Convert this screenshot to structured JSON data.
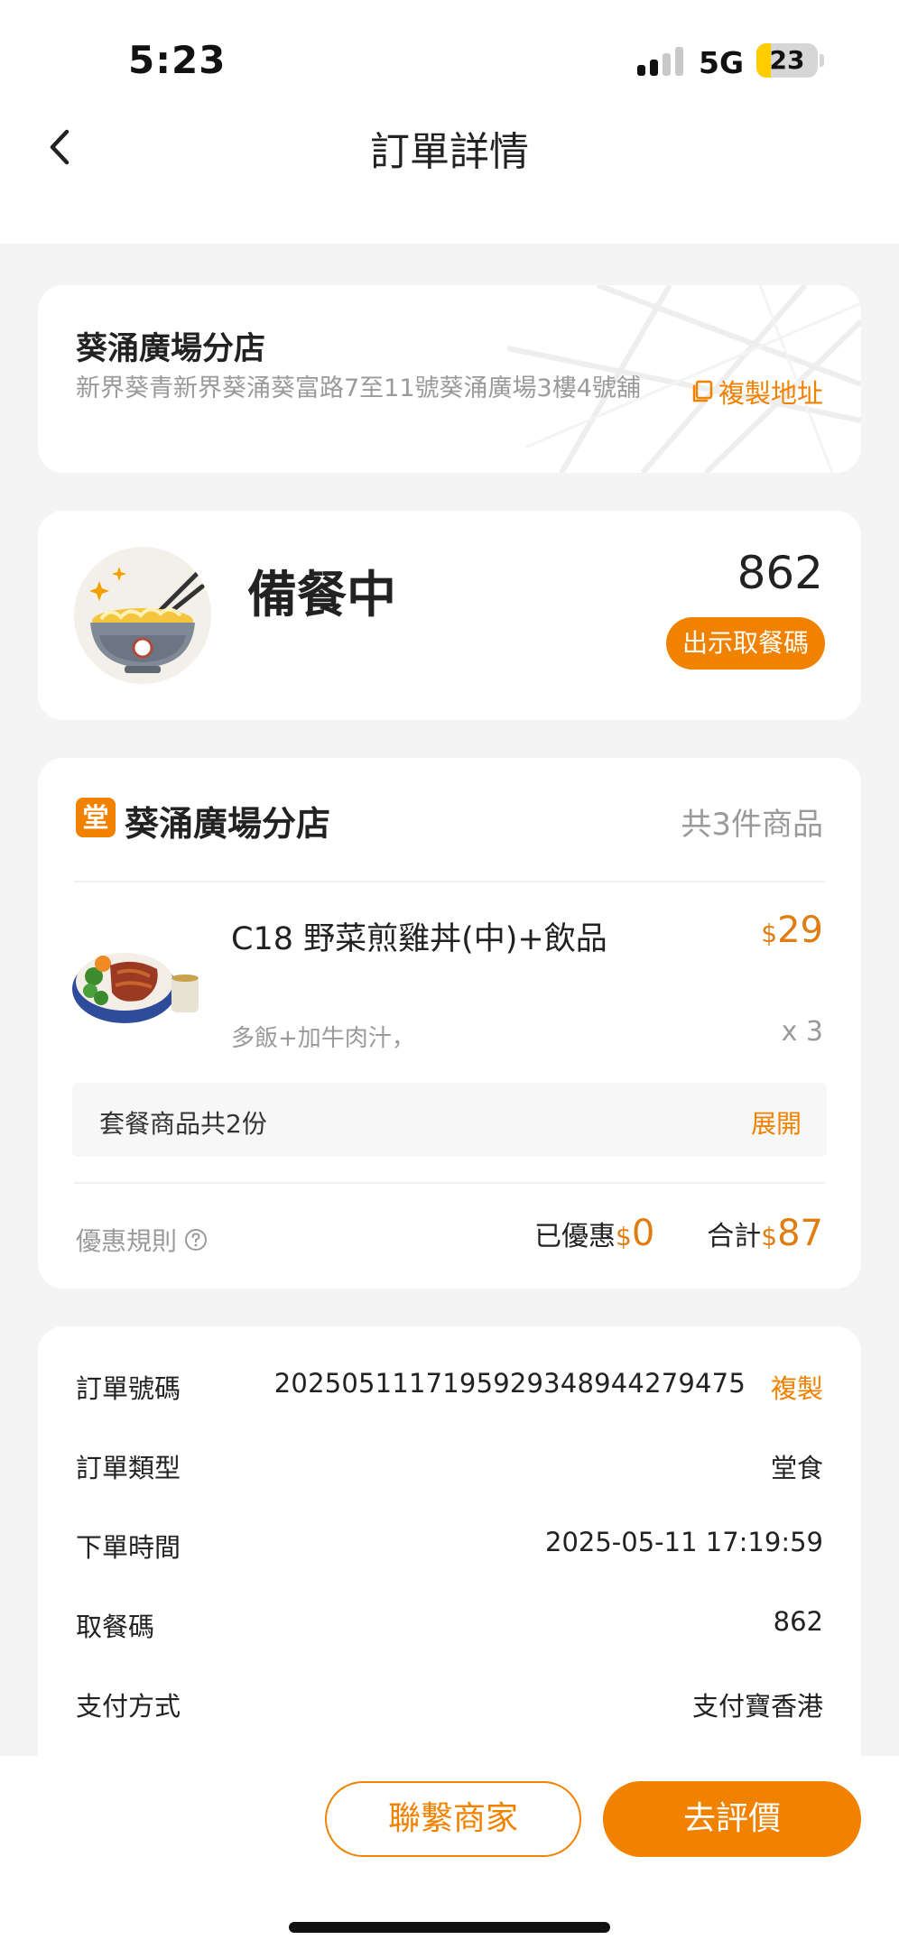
{
  "status_bar": {
    "time": "5:23",
    "network": "5G",
    "battery_level": "23",
    "battery_fraction": 0.23,
    "signal_bars_active": 2,
    "signal_bars_total": 4
  },
  "header": {
    "title": "訂單詳情",
    "back_icon": "chevron-left-icon"
  },
  "store": {
    "name": "葵涌廣場分店",
    "address": "新界葵青新界葵涌葵富路7至11號葵涌廣場3樓4號舖",
    "copy_address_label": "複製地址"
  },
  "order_status": {
    "status": "備餐中",
    "pickup_number": "862",
    "show_code_label": "出示取餐碼"
  },
  "items_section": {
    "badge": "堂",
    "store_name": "葵涌廣場分店",
    "item_count": "共3件商品",
    "items": [
      {
        "name": "C18 野菜煎雞丼(中)+飲品",
        "currency": "$",
        "price": "29",
        "options": "多飯+加牛肉汁，",
        "quantity": "x 3"
      }
    ],
    "set_panel": {
      "label": "套餐商品共2份",
      "expand_label": "展開"
    },
    "promo_rules_label": "優惠規則",
    "discount_label": "已優惠",
    "discount_currency": "$",
    "discount_amount": "0",
    "total_label": "合計",
    "total_currency": "$",
    "total_amount": "87"
  },
  "order_info": {
    "rows": [
      {
        "label": "訂單號碼",
        "value": "2025051117195929348944279475",
        "action": "複製"
      },
      {
        "label": "訂單類型",
        "value": "堂食"
      },
      {
        "label": "下單時間",
        "value": "2025-05-11 17:19:59"
      },
      {
        "label": "取餐碼",
        "value": "862"
      },
      {
        "label": "支付方式",
        "value": "支付寶香港"
      }
    ]
  },
  "bottom_actions": {
    "contact_label": "聯繫商家",
    "review_label": "去評價"
  },
  "colors": {
    "accent": "#f08200",
    "price": "#e07d10",
    "background": "#f4f4f4",
    "muted_text": "#9a9a9a"
  }
}
